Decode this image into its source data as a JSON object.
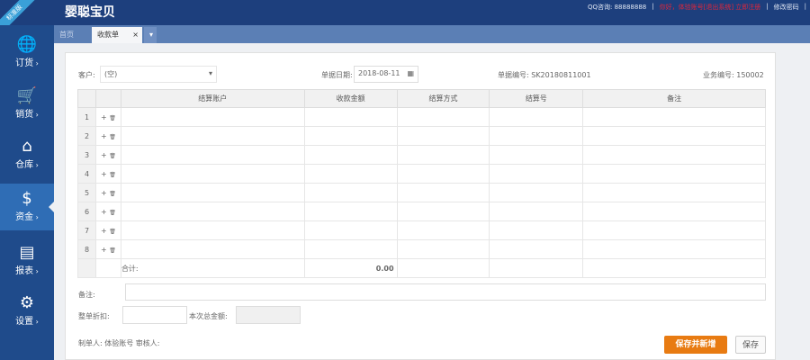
{
  "header": {
    "logo": "婴聪宝贝",
    "ribbon": "标准版",
    "qq": "QQ咨询: 88888888",
    "notice": "你好，体验账号[退出系统] 立即注册",
    "change_password": "修改密码"
  },
  "tabs": {
    "home": "首页",
    "active": "收款单",
    "close": "×",
    "more": "▾"
  },
  "sidebar": [
    {
      "label": "订货",
      "icon": "globe-icon",
      "glyph": "🌐"
    },
    {
      "label": "销货",
      "icon": "cart-icon",
      "glyph": "🛒"
    },
    {
      "label": "仓库",
      "icon": "home-icon",
      "glyph": "⌂"
    },
    {
      "label": "资金",
      "icon": "dollar-icon",
      "glyph": "$"
    },
    {
      "label": "报表",
      "icon": "report-icon",
      "glyph": "▤"
    },
    {
      "label": "设置",
      "icon": "gear-icon",
      "glyph": "⚙"
    }
  ],
  "form": {
    "customer_label": "客户:",
    "customer_value": "(空)",
    "date_label": "单据日期:",
    "date_value": "2018-08-11",
    "bill_no": "单据编号: SK20180811001",
    "biz_no": "业务编号: 150002"
  },
  "table": {
    "headers": [
      "结算账户",
      "收款金额",
      "结算方式",
      "结算号",
      "备注"
    ],
    "rows": [
      "1",
      "2",
      "3",
      "4",
      "5",
      "6",
      "7",
      "8"
    ],
    "add": "+",
    "del": "🗑",
    "total_label": "合计:",
    "total_amount": "0.00"
  },
  "footer": {
    "remark_label": "备注:",
    "discount_label": "整单折扣:",
    "total_label": "本次总金额:",
    "creator": "制单人: 体验账号 审核人:",
    "save_new": "保存并新增",
    "save": "保存"
  }
}
